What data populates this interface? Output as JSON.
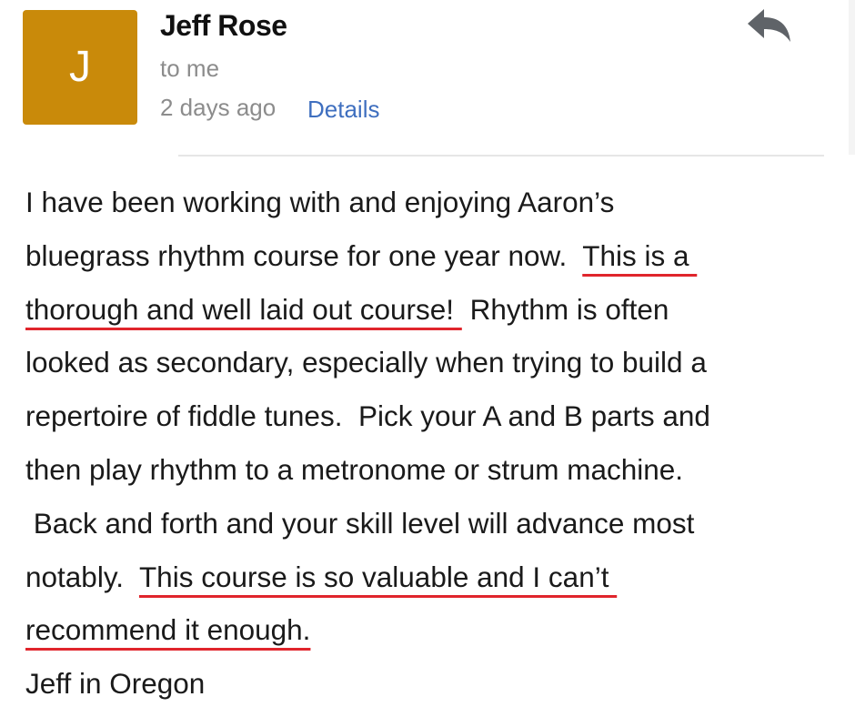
{
  "message": {
    "avatar_letter": "J",
    "sender": "Jeff Rose",
    "recipient": "to me",
    "date": "2 days ago",
    "details_link": "Details",
    "reply_icon": "reply-arrow-icon",
    "colors": {
      "avatar_bg": "#c98a0a",
      "link": "#3f6fbf",
      "underline": "#e0252c"
    },
    "body": {
      "l1": "I have been working with and enjoying Aaron’s",
      "l2a": "bluegrass rhythm course for one year now.  ",
      "l2b": "This is a ",
      "l3a": "thorough and well laid out course! ",
      "l3b": " Rhythm is often",
      "l4": "looked as secondary, especially when trying to build a",
      "l5": "repertoire of fiddle tunes.  Pick your A and B parts and",
      "l6": "then play rhythm to a metronome or strum machine.",
      "l7": " Back and forth and your skill level will advance most",
      "l8a": "notably.  ",
      "l8b": "This course is so valuable and I can’t ",
      "l9": "recommend it enough.",
      "l10": "Jeff in Oregon"
    }
  }
}
